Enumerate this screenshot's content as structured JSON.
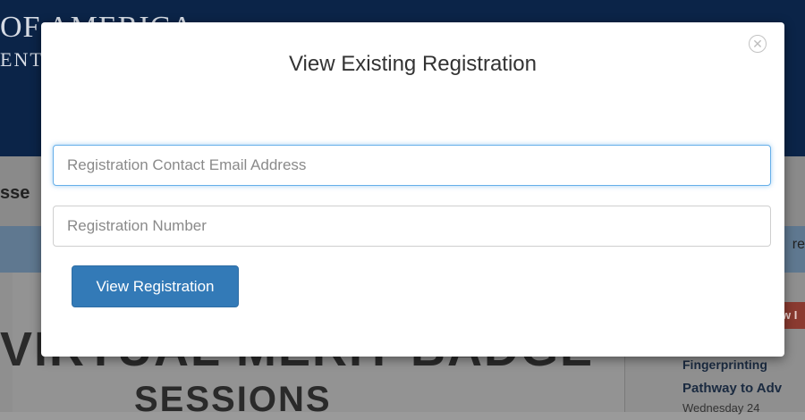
{
  "background": {
    "logo_line1": "OF AMERICA",
    "logo_line2": "ENT",
    "nav_fragment": "sse",
    "band_fragment": "re",
    "heading_line1": "VIRTUAL MERIT BADGE",
    "heading_line2": "SESSIONS",
    "badge_fragment": "w I",
    "sidebar_line1": "Fingerprinting",
    "sidebar_line2": "Pathway to Adv",
    "sidebar_line3": "Wednesday 24"
  },
  "modal": {
    "title": "View Existing Registration",
    "close_icon": "close-circle-icon",
    "email_placeholder": "Registration Contact Email Address",
    "email_value": "",
    "number_placeholder": "Registration Number",
    "number_value": "",
    "submit_label": "View Registration"
  },
  "colors": {
    "primary": "#337ab7",
    "header": "#0b2448",
    "focus": "#66afe9"
  }
}
